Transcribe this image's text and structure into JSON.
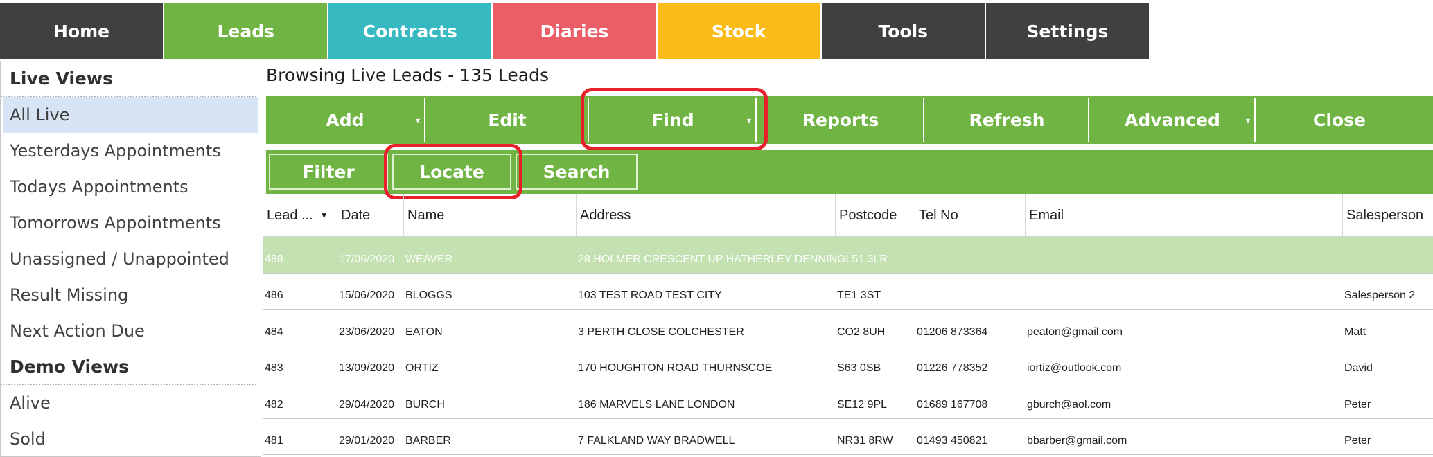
{
  "nav": {
    "tabs": [
      {
        "label": "Home",
        "color": "#404040"
      },
      {
        "label": "Leads",
        "color": "#70b544"
      },
      {
        "label": "Contracts",
        "color": "#36b9c0"
      },
      {
        "label": "Diaries",
        "color": "#eb5e68"
      },
      {
        "label": "Stock",
        "color": "#fbbc1a"
      },
      {
        "label": "Tools",
        "color": "#404040"
      },
      {
        "label": "Settings",
        "color": "#404040"
      }
    ]
  },
  "sidebar": {
    "live_title": "Live Views",
    "live_items": [
      "All Live",
      "Yesterdays Appointments",
      "Todays Appointments",
      "Tomorrows Appointments",
      "Unassigned / Unappointed",
      "Result Missing",
      "Next Action Due"
    ],
    "demo_title": "Demo Views",
    "demo_items": [
      "Alive",
      "Sold"
    ]
  },
  "main": {
    "title": "Browsing Live Leads - 135 Leads"
  },
  "toolbar": {
    "add": "Add",
    "edit": "Edit",
    "find": "Find",
    "reports": "Reports",
    "refresh": "Refresh",
    "advanced": "Advanced",
    "close": "Close",
    "filter": "Filter",
    "locate": "Locate",
    "search": "Search"
  },
  "table": {
    "headers": [
      "Lead ...",
      "Date",
      "Name",
      "Address",
      "Postcode",
      "Tel No",
      "Email",
      "Salesperson"
    ],
    "rows": [
      [
        "488",
        "17/06/2020",
        "WEAVER",
        "28 HOLMER CRESCENT UP HATHERLEY DENNING",
        "GL51 3LR",
        "",
        "",
        ""
      ],
      [
        "486",
        "15/06/2020",
        "BLOGGS",
        "103 TEST ROAD TEST CITY",
        "TE1 3ST",
        "",
        "",
        "Salesperson 2"
      ],
      [
        "484",
        "23/06/2020",
        "EATON",
        "3 PERTH CLOSE COLCHESTER",
        "CO2 8UH",
        "01206 873364",
        "peaton@gmail.com",
        "Matt"
      ],
      [
        "483",
        "13/09/2020",
        "ORTIZ",
        "170 HOUGHTON ROAD THURNSCOE",
        "S63 0SB",
        "01226 778352",
        "iortiz@outlook.com",
        "David"
      ],
      [
        "482",
        "29/04/2020",
        "BURCH",
        "186 MARVELS LANE LONDON",
        "SE12 9PL",
        "01689 167708",
        "gburch@aol.com",
        "Peter"
      ],
      [
        "481",
        "29/01/2020",
        "BARBER",
        "7 FALKLAND WAY BRADWELL",
        "NR31 8RW",
        "01493 450821",
        "bbarber@gmail.com",
        "Peter"
      ]
    ]
  }
}
